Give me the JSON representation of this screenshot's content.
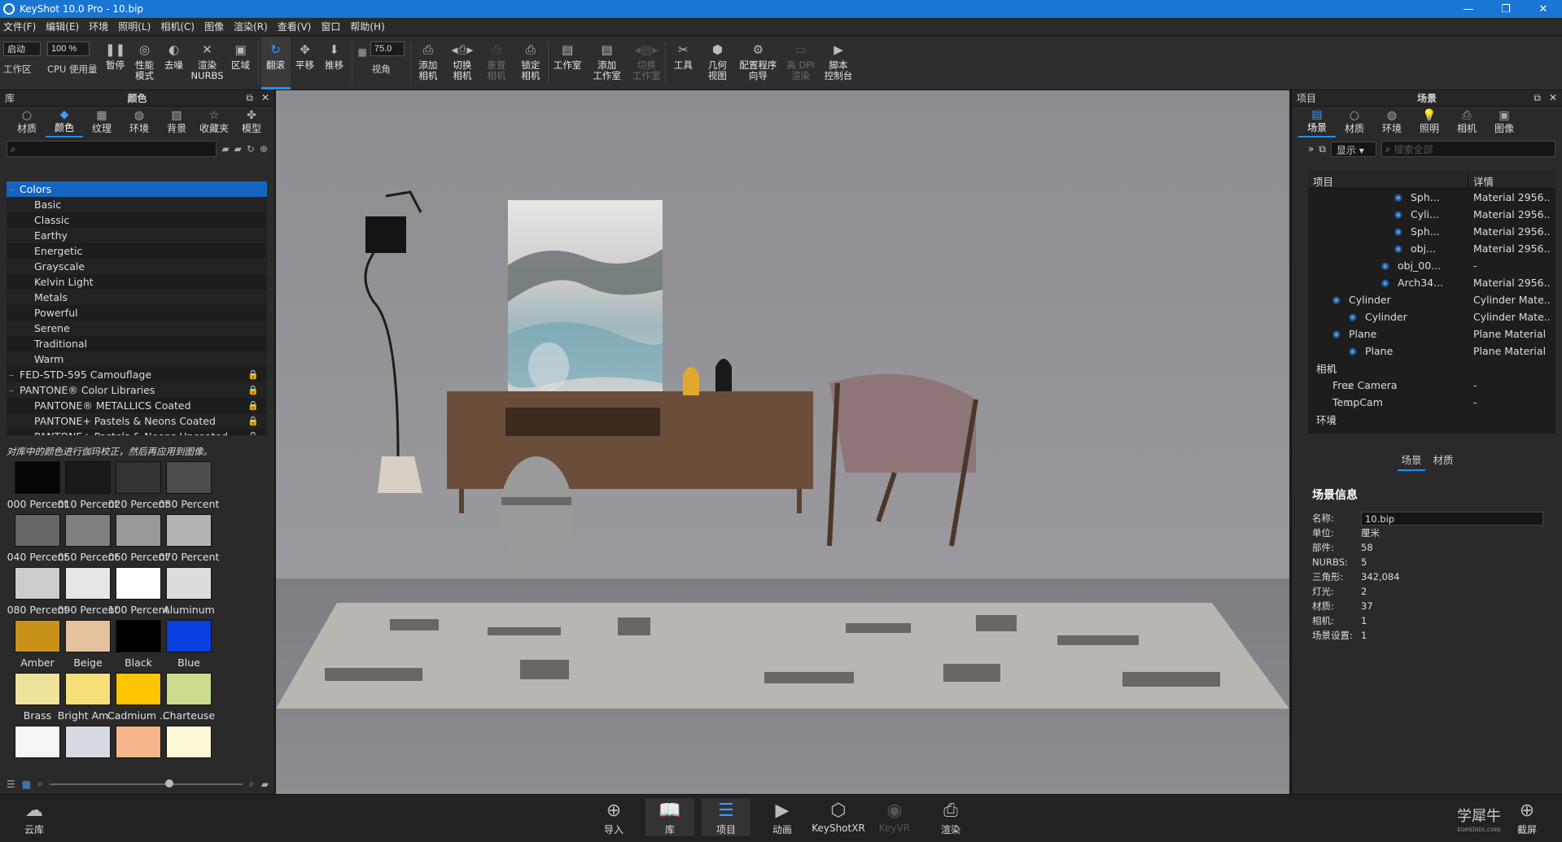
{
  "window": {
    "title": "KeyShot 10.0 Pro  - 10.bip",
    "minimize": "—",
    "restore": "❐",
    "close": "✕"
  },
  "menu": [
    "文件(F)",
    "编辑(E)",
    "环境",
    "照明(L)",
    "相机(C)",
    "图像",
    "渲染(R)",
    "查看(V)",
    "窗口",
    "帮助(H)"
  ],
  "ribbon": {
    "mode_value": "启动",
    "workspace_label": "工作区",
    "cpu_value": "100 %",
    "cpu_label": "CPU 使用量",
    "items": [
      {
        "label": "暂停",
        "icon": "pause-icon",
        "glyph": "❚❚",
        "state": "normal"
      },
      {
        "label": "性能\n模式",
        "icon": "performance-icon",
        "glyph": "◎",
        "state": "normal"
      },
      {
        "label": "去噪",
        "icon": "denoise-icon",
        "glyph": "◐",
        "state": "normal"
      },
      {
        "label": "渲染\nNURBS",
        "icon": "nurbs-icon",
        "glyph": "✕",
        "state": "normal"
      },
      {
        "label": "区域",
        "icon": "region-icon",
        "glyph": "▣",
        "state": "normal"
      }
    ],
    "nav": [
      {
        "label": "翻滚",
        "icon": "tumble-icon",
        "glyph": "↻",
        "state": "active"
      },
      {
        "label": "平移",
        "icon": "pan-icon",
        "glyph": "✥",
        "state": "normal"
      },
      {
        "label": "推移",
        "icon": "dolly-icon",
        "glyph": "⬇",
        "state": "normal"
      }
    ],
    "fov_value": "75.0",
    "fov_label": "视角",
    "camera": [
      {
        "label": "添加\n相机",
        "icon": "add-camera-icon",
        "glyph": "⎙",
        "state": "normal"
      },
      {
        "label": "切换\n相机",
        "icon": "switch-camera-icon",
        "glyph": "◂⎙▸",
        "state": "normal"
      },
      {
        "label": "重置\n相机",
        "icon": "reset-camera-icon",
        "glyph": "⎙",
        "state": "dim"
      },
      {
        "label": "锁定\n相机",
        "icon": "lock-camera-icon",
        "glyph": "⎙",
        "state": "normal"
      }
    ],
    "studio": [
      {
        "label": "工作室",
        "icon": "studio-icon",
        "glyph": "▤",
        "state": "normal"
      },
      {
        "label": "添加\n工作室",
        "icon": "add-studio-icon",
        "glyph": "▤",
        "state": "normal"
      },
      {
        "label": "切换\n工作室",
        "icon": "switch-studio-icon",
        "glyph": "◂▤▸",
        "state": "dim"
      }
    ],
    "tools": [
      {
        "label": "工具",
        "icon": "tools-icon",
        "glyph": "✂",
        "state": "normal"
      },
      {
        "label": "几何\n视图",
        "icon": "geometry-view-icon",
        "glyph": "⬢",
        "state": "normal"
      },
      {
        "label": "配置程序\n向导",
        "icon": "configurator-wizard-icon",
        "glyph": "⚙",
        "state": "normal"
      },
      {
        "label": "高 DPI\n渲染",
        "icon": "hidpi-render-icon",
        "glyph": "▭",
        "state": "dim"
      },
      {
        "label": "脚本\n控制台",
        "icon": "script-console-icon",
        "glyph": "▶",
        "state": "normal"
      }
    ]
  },
  "library": {
    "header_left": "库",
    "header_center": "颜色",
    "tabs": [
      {
        "label": "材质",
        "icon": "materials-icon",
        "glyph": "○"
      },
      {
        "label": "颜色",
        "icon": "colors-icon",
        "glyph": "◆",
        "selected": true
      },
      {
        "label": "纹理",
        "icon": "textures-icon",
        "glyph": "▦"
      },
      {
        "label": "环境",
        "icon": "environments-icon",
        "glyph": "◍"
      },
      {
        "label": "背景",
        "icon": "backplates-icon",
        "glyph": "▨"
      },
      {
        "label": "收藏夹",
        "icon": "favorites-icon",
        "glyph": "☆"
      },
      {
        "label": "模型",
        "icon": "models-icon",
        "glyph": "✤"
      }
    ],
    "search_placeholder": "",
    "tree": [
      {
        "label": "Colors",
        "level": 0,
        "selected": true,
        "locked": false
      },
      {
        "label": "Basic",
        "level": 1,
        "locked": false
      },
      {
        "label": "Classic",
        "level": 1,
        "locked": false
      },
      {
        "label": "Earthy",
        "level": 1,
        "locked": false
      },
      {
        "label": "Energetic",
        "level": 1,
        "locked": false
      },
      {
        "label": "Grayscale",
        "level": 1,
        "locked": false
      },
      {
        "label": "Kelvin Light",
        "level": 1,
        "locked": false
      },
      {
        "label": "Metals",
        "level": 1,
        "locked": false
      },
      {
        "label": "Powerful",
        "level": 1,
        "locked": false
      },
      {
        "label": "Serene",
        "level": 1,
        "locked": false
      },
      {
        "label": "Traditional",
        "level": 1,
        "locked": false
      },
      {
        "label": "Warm",
        "level": 1,
        "locked": false
      },
      {
        "label": "FED-STD-595 Camouflage",
        "level": 0,
        "locked": true
      },
      {
        "label": "PANTONE® Color Libraries",
        "level": 0,
        "locked": true
      },
      {
        "label": "PANTONE® METALLICS Coated",
        "level": 1,
        "locked": true
      },
      {
        "label": "PANTONE+ Pastels & Neons Coated",
        "level": 1,
        "locked": true
      },
      {
        "label": "PANTONE+ Pastels & Neons Uncoated",
        "level": 1,
        "locked": true
      }
    ],
    "hint": "对库中的颜色进行伽玛校正，然后再应用到图像。",
    "swatches": [
      {
        "label": "000 Percent",
        "color": "#050505"
      },
      {
        "label": "010 Percent",
        "color": "#1a1a1a"
      },
      {
        "label": "020 Percent",
        "color": "#333333"
      },
      {
        "label": "030 Percent",
        "color": "#4c4c4c"
      },
      {
        "label": "040 Percent",
        "color": "#666666"
      },
      {
        "label": "050 Percent",
        "color": "#808080"
      },
      {
        "label": "060 Percent",
        "color": "#999999"
      },
      {
        "label": "070 Percent",
        "color": "#b3b3b3"
      },
      {
        "label": "080 Percent",
        "color": "#cccccc"
      },
      {
        "label": "090 Percent",
        "color": "#e6e6e6"
      },
      {
        "label": "100 Percent",
        "color": "#ffffff"
      },
      {
        "label": "Aluminum",
        "color": "#dcdcdc"
      },
      {
        "label": "Amber",
        "color": "#c8921a"
      },
      {
        "label": "Beige",
        "color": "#e5c19d"
      },
      {
        "label": "Black",
        "color": "#000000"
      },
      {
        "label": "Blue",
        "color": "#0a3fe0"
      },
      {
        "label": "Brass",
        "color": "#efe39b"
      },
      {
        "label": "Bright Am...",
        "color": "#f6e07a"
      },
      {
        "label": "Cadmium ...",
        "color": "#ffc400"
      },
      {
        "label": "Charteuse",
        "color": "#cbdc8f"
      },
      {
        "label": "",
        "color": "#f6f6f6"
      },
      {
        "label": "",
        "color": "#d7dae0"
      },
      {
        "label": "",
        "color": "#f7b58b"
      },
      {
        "label": "",
        "color": "#fbf8d6"
      }
    ]
  },
  "project": {
    "header_left": "项目",
    "header_center": "场景",
    "tabs": [
      {
        "label": "场景",
        "icon": "scene-icon",
        "glyph": "▤",
        "selected": true
      },
      {
        "label": "材质",
        "icon": "material-icon",
        "glyph": "○"
      },
      {
        "label": "环境",
        "icon": "environment-icon",
        "glyph": "◍"
      },
      {
        "label": "照明",
        "icon": "lighting-icon",
        "glyph": "💡"
      },
      {
        "label": "相机",
        "icon": "camera-icon",
        "glyph": "⎙"
      },
      {
        "label": "图像",
        "icon": "image-icon",
        "glyph": "▣"
      }
    ],
    "display_label": "显示",
    "search_placeholder": "搜索全部",
    "col_item": "项目",
    "col_detail": "详情",
    "rows": [
      {
        "name": "Sph...",
        "detail": "Material 2956...",
        "indent": 156,
        "eye": true
      },
      {
        "name": "Cyli...",
        "detail": "Material 2956...",
        "indent": 156,
        "eye": true
      },
      {
        "name": "Sph...",
        "detail": "Material 2956...",
        "indent": 156,
        "eye": true
      },
      {
        "name": "obj...",
        "detail": "Material 2956...",
        "indent": 156,
        "eye": true
      },
      {
        "name": "obj_00...",
        "detail": "-",
        "indent": 140,
        "eye": true
      },
      {
        "name": "Arch34...",
        "detail": "Material 2956...",
        "indent": 140,
        "eye": true
      },
      {
        "name": "Cylinder",
        "detail": "Cylinder Mate...",
        "indent": 80,
        "eye": true
      },
      {
        "name": "Cylinder",
        "detail": "Cylinder Mate...",
        "indent": 100,
        "eye": true
      },
      {
        "name": "Plane",
        "detail": "Plane Material",
        "indent": 80,
        "eye": true
      },
      {
        "name": "Plane",
        "detail": "Plane Material",
        "indent": 100,
        "eye": true
      },
      {
        "name": "相机",
        "detail": "",
        "indent": 40,
        "eye": false
      },
      {
        "name": "Free Camera",
        "detail": "-",
        "indent": 60,
        "eye": false
      },
      {
        "name": "TempCam",
        "detail": "-",
        "indent": 60,
        "eye": false
      },
      {
        "name": "环境",
        "detail": "",
        "indent": 40,
        "eye": false
      }
    ],
    "subtab_scene": "场景",
    "subtab_material": "材质",
    "info_title": "场景信息",
    "info": [
      {
        "k": "名称:",
        "v": "10.bip",
        "input": true
      },
      {
        "k": "单位:",
        "v": "厘米"
      },
      {
        "k": "部件:",
        "v": "58"
      },
      {
        "k": "NURBS:",
        "v": "5"
      },
      {
        "k": "三角形:",
        "v": "342,084"
      },
      {
        "k": "灯光:",
        "v": "2"
      },
      {
        "k": "材质:",
        "v": "37"
      },
      {
        "k": "相机:",
        "v": "1"
      },
      {
        "k": "场景设置:",
        "v": "1"
      }
    ]
  },
  "bottom": {
    "cloud": "云库",
    "items": [
      {
        "label": "导入",
        "icon": "import-icon",
        "glyph": "⊕",
        "state": "normal"
      },
      {
        "label": "库",
        "icon": "library-icon",
        "glyph": "📖",
        "state": "selected"
      },
      {
        "label": "项目",
        "icon": "project-icon",
        "glyph": "☰",
        "state": "selected"
      },
      {
        "label": "动画",
        "icon": "animation-icon",
        "glyph": "▶",
        "state": "normal"
      },
      {
        "label": "KeyShotXR",
        "icon": "keyshotxr-icon",
        "glyph": "⬡",
        "state": "normal"
      },
      {
        "label": "KeyVR",
        "icon": "keyvr-icon",
        "glyph": "◉",
        "state": "dim"
      },
      {
        "label": "渲染",
        "icon": "render-icon",
        "glyph": "⎙",
        "state": "normal"
      }
    ],
    "screenshot": "截屏",
    "watermark": "学犀牛",
    "watermark_sub": "xuexiniu.com"
  }
}
